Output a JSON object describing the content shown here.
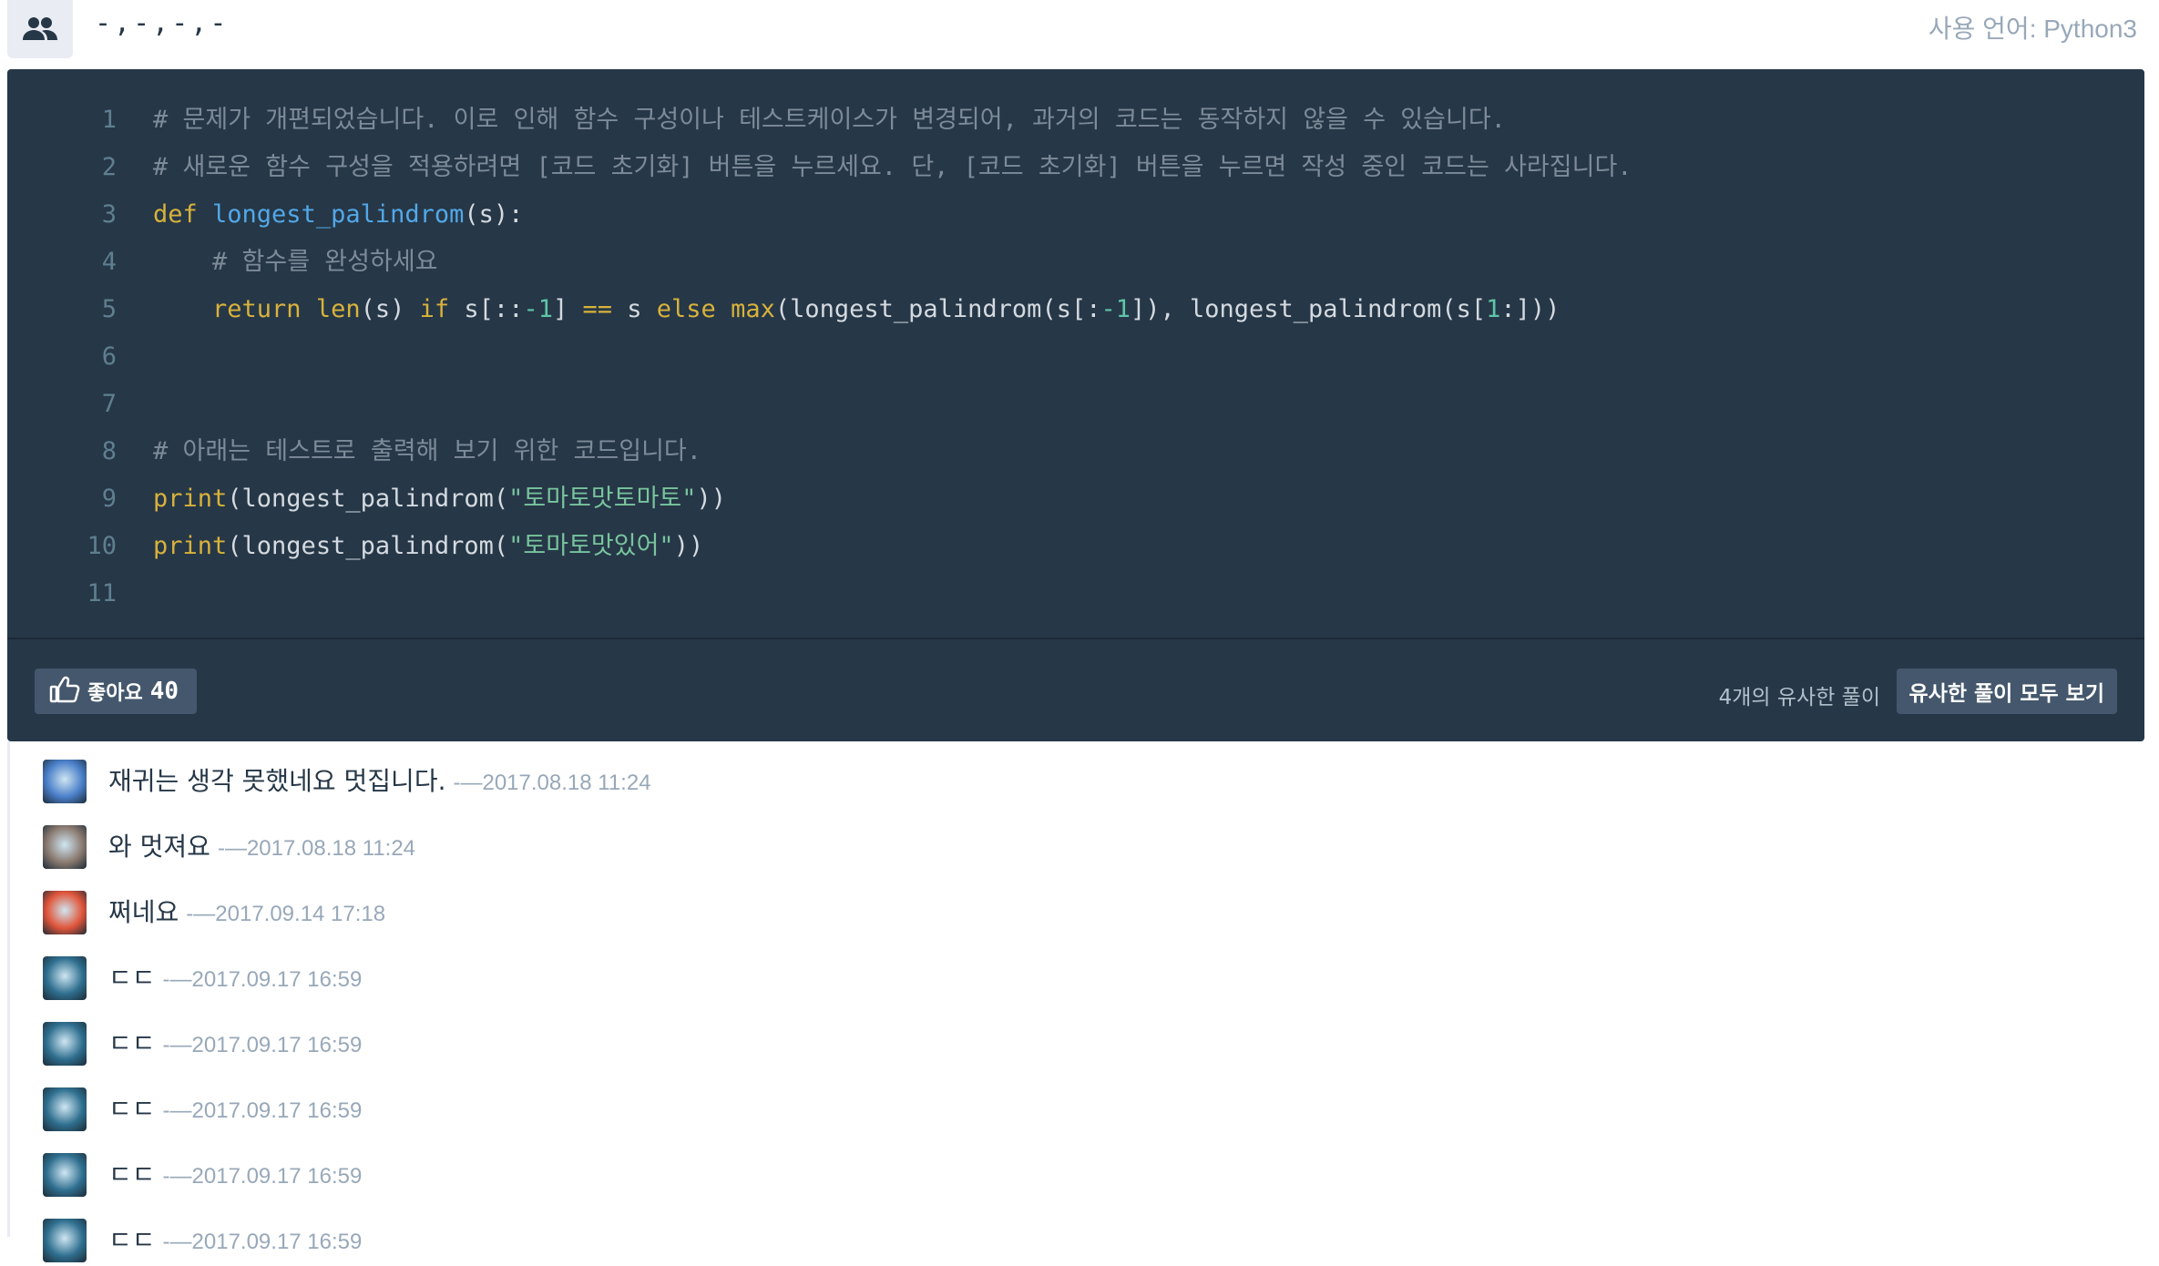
{
  "header": {
    "user_icon": "users-icon",
    "user_name": "-,-,-,-",
    "language": "사용 언어: Python3"
  },
  "code": {
    "lines": [
      {
        "num": "1",
        "tokens": [
          {
            "t": "# 문제가 개편되었습니다. 이로 인해 함수 구성이나 테스트케이스가 변경되어, 과거의 코드는 동작하지 않을 수 있습니다.",
            "c": "cm"
          }
        ]
      },
      {
        "num": "2",
        "tokens": [
          {
            "t": "# 새로운 함수 구성을 적용하려면 [코드 초기화] 버튼을 누르세요. 단, [코드 초기화] 버튼을 누르면 작성 중인 코드는 사라집니다.",
            "c": "cm"
          }
        ]
      },
      {
        "num": "3",
        "tokens": [
          {
            "t": "def ",
            "c": "kw"
          },
          {
            "t": "longest_palindrom",
            "c": "fn"
          },
          {
            "t": "(s):",
            "c": ""
          }
        ]
      },
      {
        "num": "4",
        "tokens": [
          {
            "t": "    # 함수를 완성하세요",
            "c": "cm"
          }
        ]
      },
      {
        "num": "5",
        "tokens": [
          {
            "t": "    ",
            "c": ""
          },
          {
            "t": "return ",
            "c": "kw"
          },
          {
            "t": "len",
            "c": "kw"
          },
          {
            "t": "(s) ",
            "c": ""
          },
          {
            "t": "if ",
            "c": "kw"
          },
          {
            "t": "s[::",
            "c": ""
          },
          {
            "t": "-1",
            "c": "nu"
          },
          {
            "t": "] ",
            "c": ""
          },
          {
            "t": "== ",
            "c": "kw"
          },
          {
            "t": "s ",
            "c": ""
          },
          {
            "t": "else ",
            "c": "kw"
          },
          {
            "t": "max",
            "c": "kw"
          },
          {
            "t": "(longest_palindrom(s[:",
            "c": ""
          },
          {
            "t": "-1",
            "c": "nu"
          },
          {
            "t": "]), longest_palindrom(s[",
            "c": ""
          },
          {
            "t": "1",
            "c": "nu"
          },
          {
            "t": ":]))",
            "c": ""
          }
        ]
      },
      {
        "num": "6",
        "tokens": []
      },
      {
        "num": "7",
        "tokens": []
      },
      {
        "num": "8",
        "tokens": [
          {
            "t": "# 아래는 테스트로 출력해 보기 위한 코드입니다.",
            "c": "cm"
          }
        ]
      },
      {
        "num": "9",
        "tokens": [
          {
            "t": "print",
            "c": "kw"
          },
          {
            "t": "(longest_palindrom(",
            "c": ""
          },
          {
            "t": "\"토마토맛토마토\"",
            "c": "st"
          },
          {
            "t": "))",
            "c": ""
          }
        ]
      },
      {
        "num": "10",
        "tokens": [
          {
            "t": "print",
            "c": "kw"
          },
          {
            "t": "(longest_palindrom(",
            "c": ""
          },
          {
            "t": "\"토마토맛있어\"",
            "c": "st"
          },
          {
            "t": "))",
            "c": ""
          }
        ]
      },
      {
        "num": "11",
        "tokens": []
      }
    ]
  },
  "footer": {
    "like_icon": "thumbs-up-icon",
    "like_label": "좋아요",
    "like_count": "40",
    "similar_count_text": "4개의 유사한 풀이",
    "similar_button": "유사한 풀이 모두 보기"
  },
  "comments": [
    {
      "text": "재귀는 생각 못했네요 멋집니다.",
      "time": "-—2017.08.18 11:24",
      "avatar_color": "#4a7fc9"
    },
    {
      "text": "와 멋져요",
      "time": "-—2017.08.18 11:24",
      "avatar_color": "#8a7a70"
    },
    {
      "text": "쩌네요",
      "time": "-—2017.09.14 17:18",
      "avatar_color": "#e0553a"
    },
    {
      "text": "ㄷㄷ",
      "time": "-—2017.09.17 16:59",
      "avatar_color": "#2f6f8f"
    },
    {
      "text": "ㄷㄷ",
      "time": "-—2017.09.17 16:59",
      "avatar_color": "#2f6f8f"
    },
    {
      "text": "ㄷㄷ",
      "time": "-—2017.09.17 16:59",
      "avatar_color": "#2f6f8f"
    },
    {
      "text": "ㄷㄷ",
      "time": "-—2017.09.17 16:59",
      "avatar_color": "#2f6f8f"
    },
    {
      "text": "ㄷㄷ",
      "time": "-—2017.09.17 16:59",
      "avatar_color": "#2f6f8f"
    }
  ]
}
